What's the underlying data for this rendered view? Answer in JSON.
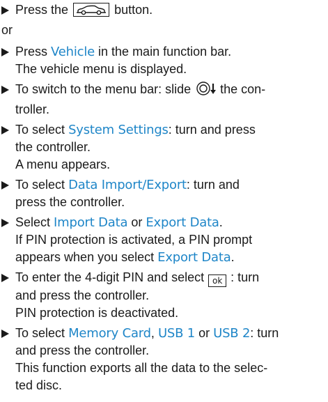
{
  "icons": {
    "bullet": "triangle-bullet-icon",
    "vehicle_button": "car-button-icon",
    "controller_slide": "controller-slide-down-icon",
    "ok_button": "ok-button-icon"
  },
  "colors": {
    "text": "#1a1a1a",
    "highlight": "#1f86c8"
  },
  "step1": {
    "prefix": "Press the",
    "suffix": "button."
  },
  "or_label": "or",
  "step2": {
    "pre": "Press",
    "highlight": "Vehicle",
    "post": "in the main function bar.",
    "result": "The vehicle menu is displayed."
  },
  "step3": {
    "pre": "To switch to the menu bar: slide",
    "post": "the con-",
    "line2": "troller."
  },
  "step4": {
    "pre": "To select",
    "highlight": "System Settings",
    "post": ": turn and press",
    "line2": "the controller.",
    "result": "A menu appears."
  },
  "step5": {
    "pre": "To select",
    "highlight": "Data Import/Export",
    "post": ": turn and",
    "line2": "press the controller."
  },
  "step6": {
    "pre": "Select",
    "highlight1": "Import Data",
    "mid": "or",
    "highlight2": "Export Data",
    "post": ".",
    "result_line1": "If PIN protection is activated, a PIN prompt",
    "result_line2_pre": "appears when you select",
    "result_highlight": "Export Data",
    "result_post": "."
  },
  "step7": {
    "pre": "To enter the 4-digit PIN and select",
    "ok_label": "ok",
    "post": ": turn",
    "line2": "and press the controller.",
    "result": "PIN protection is deactivated."
  },
  "step8": {
    "pre": "To select",
    "highlight1": "Memory Card",
    "sep": ",",
    "highlight2": "USB 1",
    "mid": "or",
    "highlight3": "USB 2",
    "post": ": turn",
    "line2": "and press the controller.",
    "result_line1": "This function exports all the data to the selec-",
    "result_line2": "ted disc."
  }
}
